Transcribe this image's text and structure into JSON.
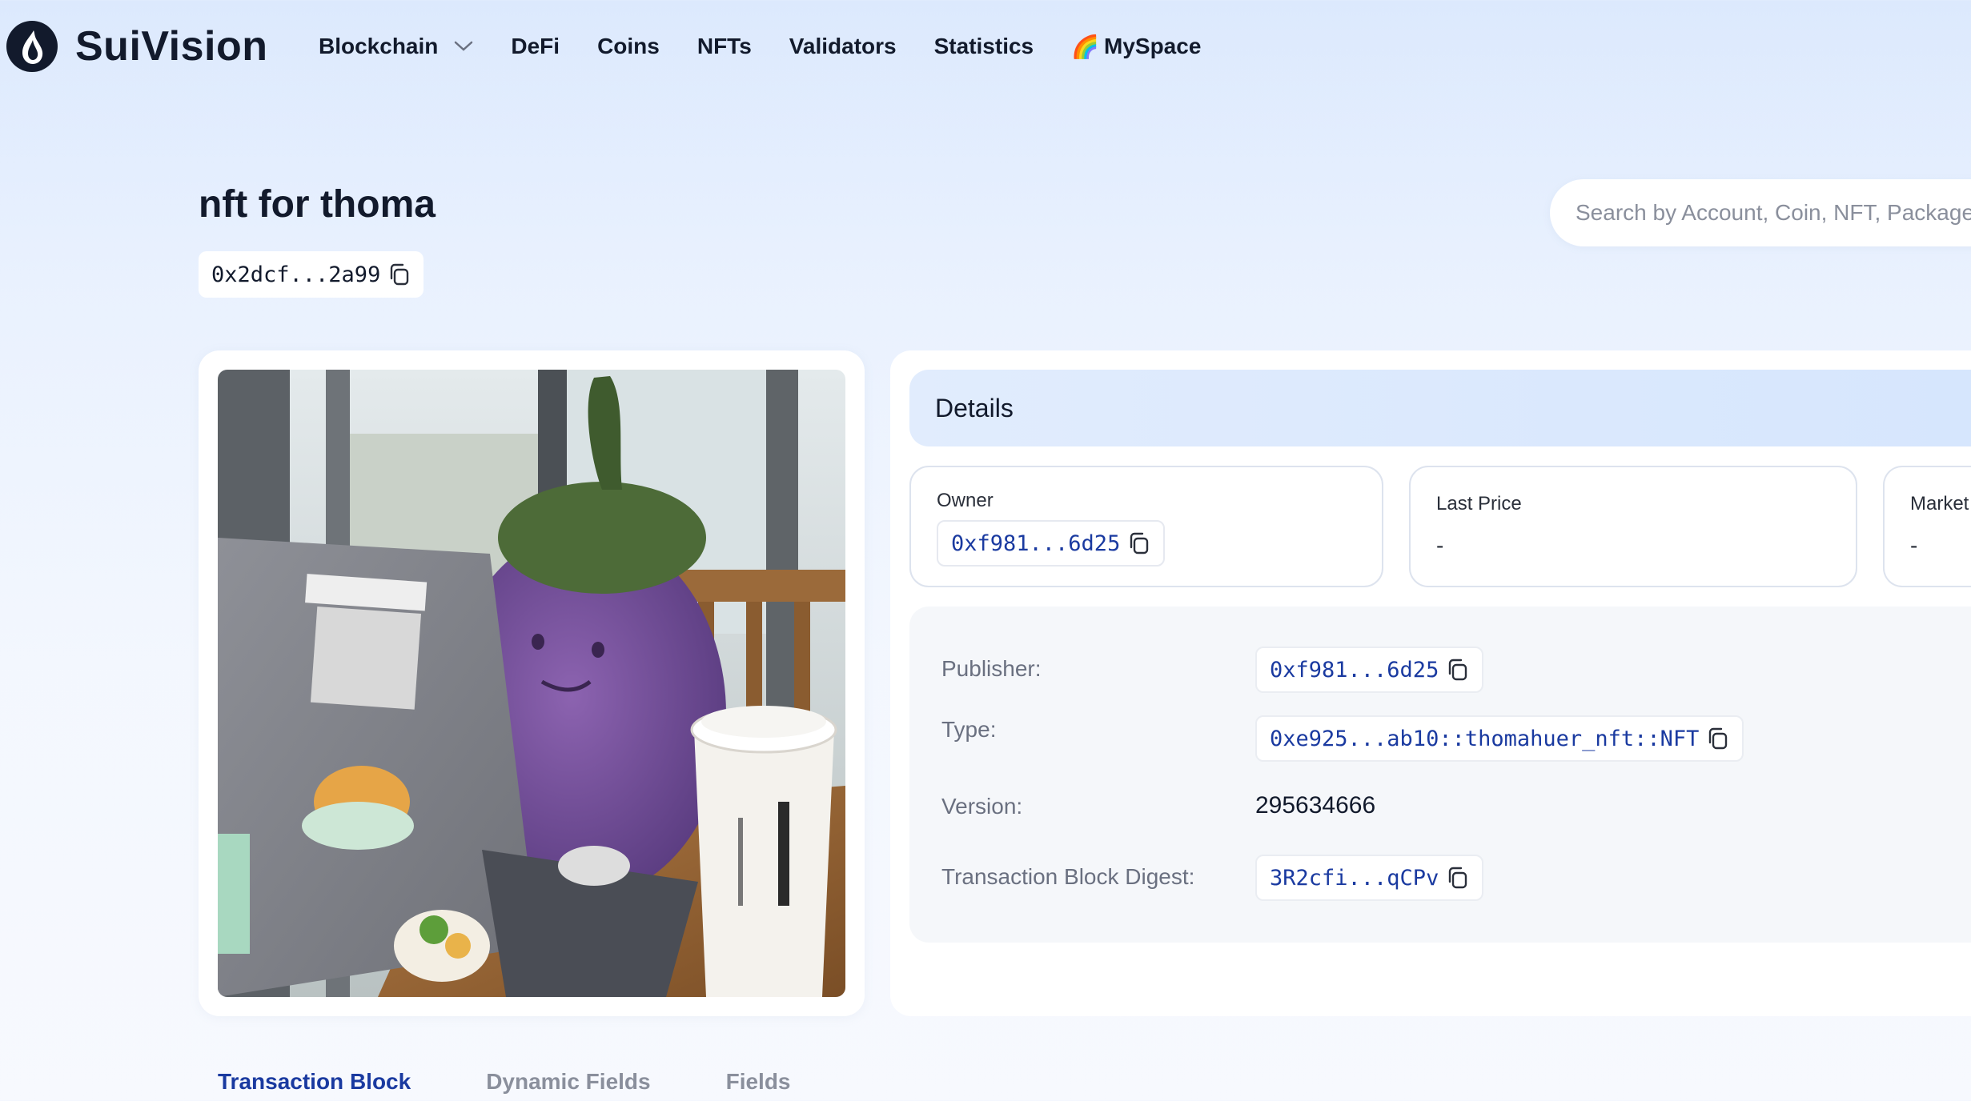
{
  "brand": {
    "name": "SuiVision"
  },
  "nav": {
    "items": [
      {
        "label": "Blockchain",
        "dropdown": true
      },
      {
        "label": "DeFi"
      },
      {
        "label": "Coins"
      },
      {
        "label": "NFTs"
      },
      {
        "label": "Validators"
      },
      {
        "label": "Statistics"
      },
      {
        "label": "MySpace",
        "emoji": "🌈"
      }
    ]
  },
  "page": {
    "title": "nft for thoma",
    "object_id": "0x2dcf...2a99"
  },
  "search": {
    "placeholder": "Search by Account, Coin, NFT, Package, Object, Transaction..."
  },
  "details": {
    "header": "Details",
    "owner": {
      "label": "Owner",
      "value": "0xf981...6d25"
    },
    "last_price": {
      "label": "Last Price",
      "value": "-"
    },
    "market": {
      "label": "Market",
      "value": "-"
    },
    "publisher": {
      "label": "Publisher:",
      "value": "0xf981...6d25"
    },
    "type": {
      "label": "Type:",
      "value": "0xe925...ab10::thomahuer_nft::NFT"
    },
    "version": {
      "label": "Version:",
      "value": "295634666"
    },
    "tx_digest": {
      "label": "Transaction Block Digest:",
      "value": "3R2cfi...qCPv"
    }
  },
  "tabs": [
    {
      "label": "Transaction Block",
      "active": true
    },
    {
      "label": "Dynamic Fields",
      "active": false
    },
    {
      "label": "Fields",
      "active": false
    }
  ],
  "colors": {
    "accent": "#1a3aa0",
    "dark": "#121a2c",
    "muted": "#8a8f9c"
  }
}
